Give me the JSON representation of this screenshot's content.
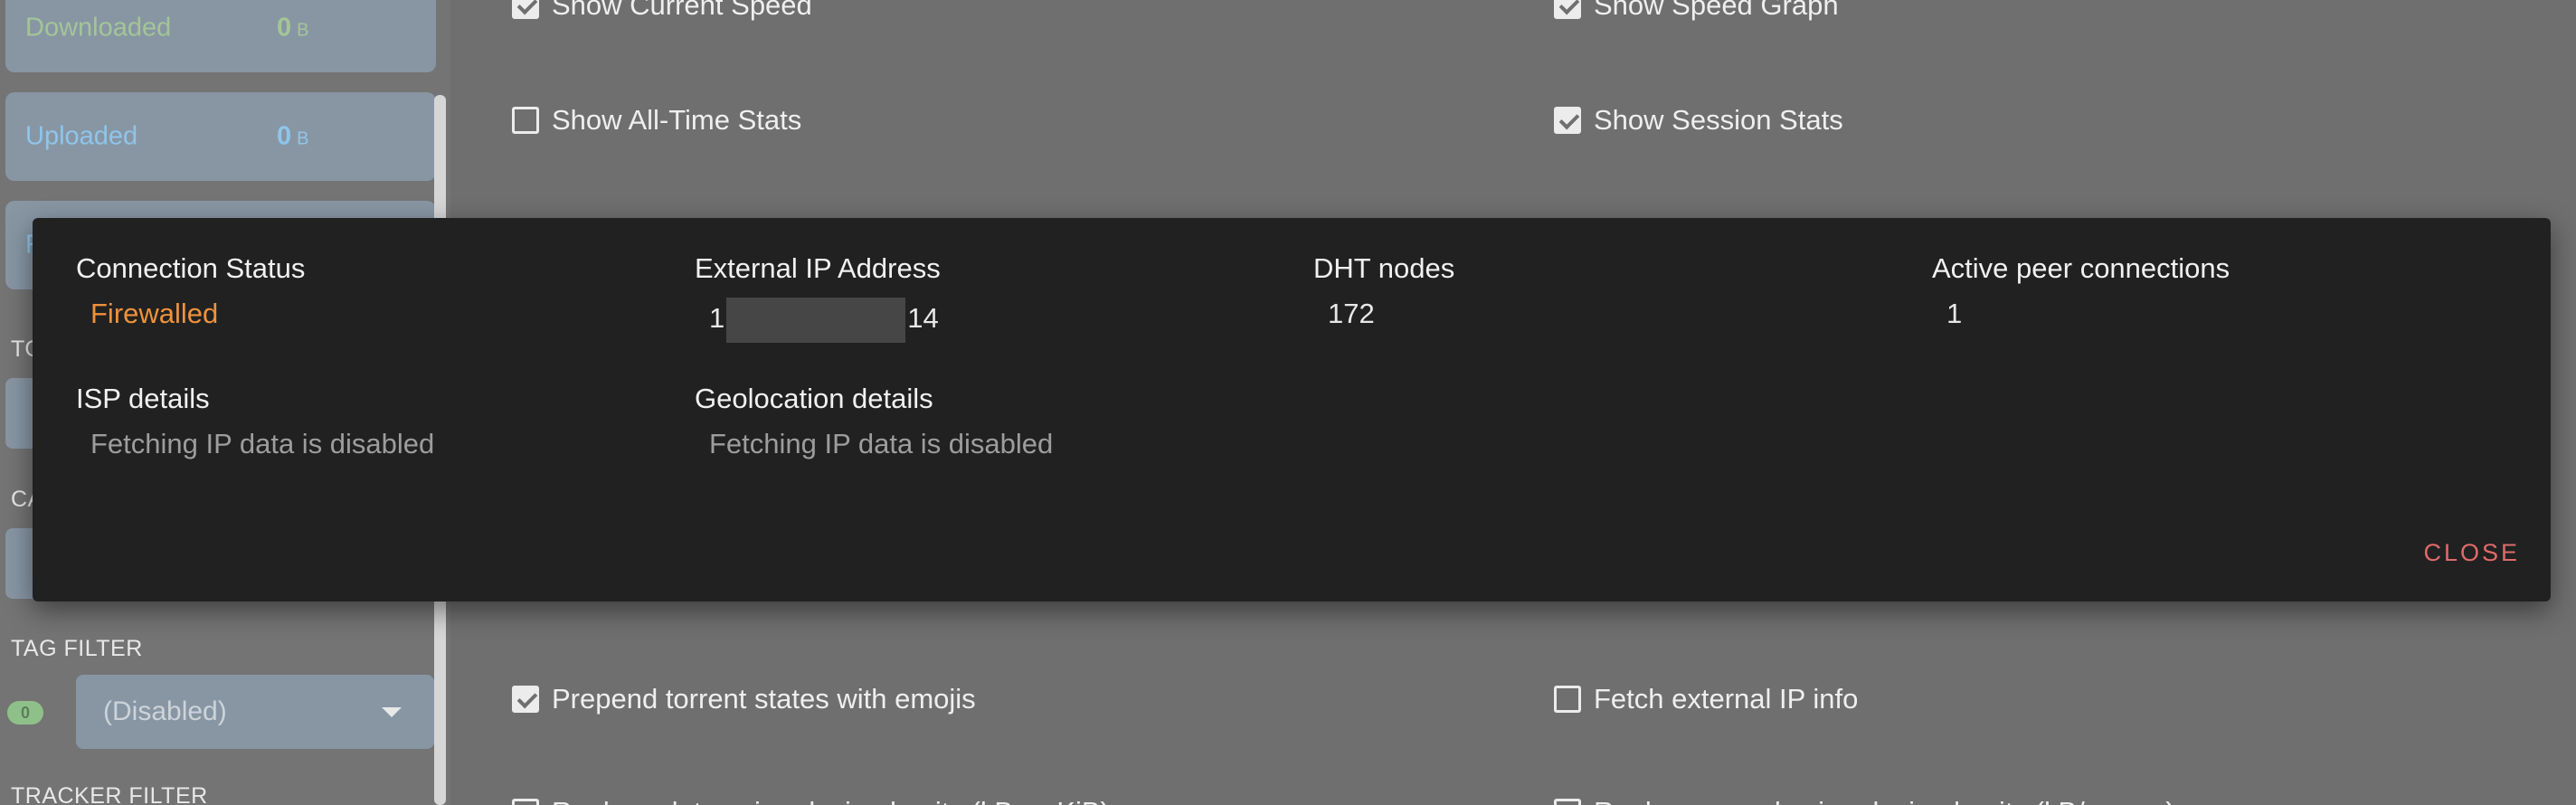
{
  "sidebar": {
    "downloaded": {
      "label": "Downloaded",
      "value": "0",
      "unit": "B"
    },
    "uploaded": {
      "label": "Uploaded",
      "value": "0",
      "unit": "B"
    },
    "ratio_partial": "R",
    "headings": {
      "torrents_partial": "TO",
      "categories_partial": "CA",
      "tag_filter": "TAG FILTER",
      "tracker_filter": "TRACKER FILTER"
    },
    "tag_filter_badge": "0",
    "tag_filter_value": "(Disabled)"
  },
  "settings": {
    "show_current_speed": {
      "label": "Show Current Speed",
      "checked": true
    },
    "show_speed_graph": {
      "label": "Show Speed Graph",
      "checked": true
    },
    "show_all_time_stats": {
      "label": "Show All-Time Stats",
      "checked": false
    },
    "show_session_stats": {
      "label": "Show Session Stats",
      "checked": true
    },
    "prepend_emojis": {
      "label": "Prepend torrent states with emojis",
      "checked": true
    },
    "fetch_external_ip": {
      "label": "Fetch external IP info",
      "checked": false
    },
    "replace_ratio_partial": {
      "label": "Replace data using decimal units (kB vs KiB)",
      "checked": false
    },
    "replace_speed_partial": {
      "label": "Replace speed using decimal units (kB/s vs ...)",
      "checked": false
    }
  },
  "dialog": {
    "connection_status": {
      "label": "Connection Status",
      "value": "Firewalled"
    },
    "external_ip": {
      "label": "External IP Address",
      "prefix": "1",
      "suffix": "14"
    },
    "dht_nodes": {
      "label": "DHT nodes",
      "value": "172"
    },
    "active_peers": {
      "label": "Active peer connections",
      "value": "1"
    },
    "isp_details": {
      "label": "ISP details",
      "value": "Fetching IP data is disabled"
    },
    "geolocation_details": {
      "label": "Geolocation details",
      "value": "Fetching IP data is disabled"
    },
    "close_label": "CLOSE"
  }
}
